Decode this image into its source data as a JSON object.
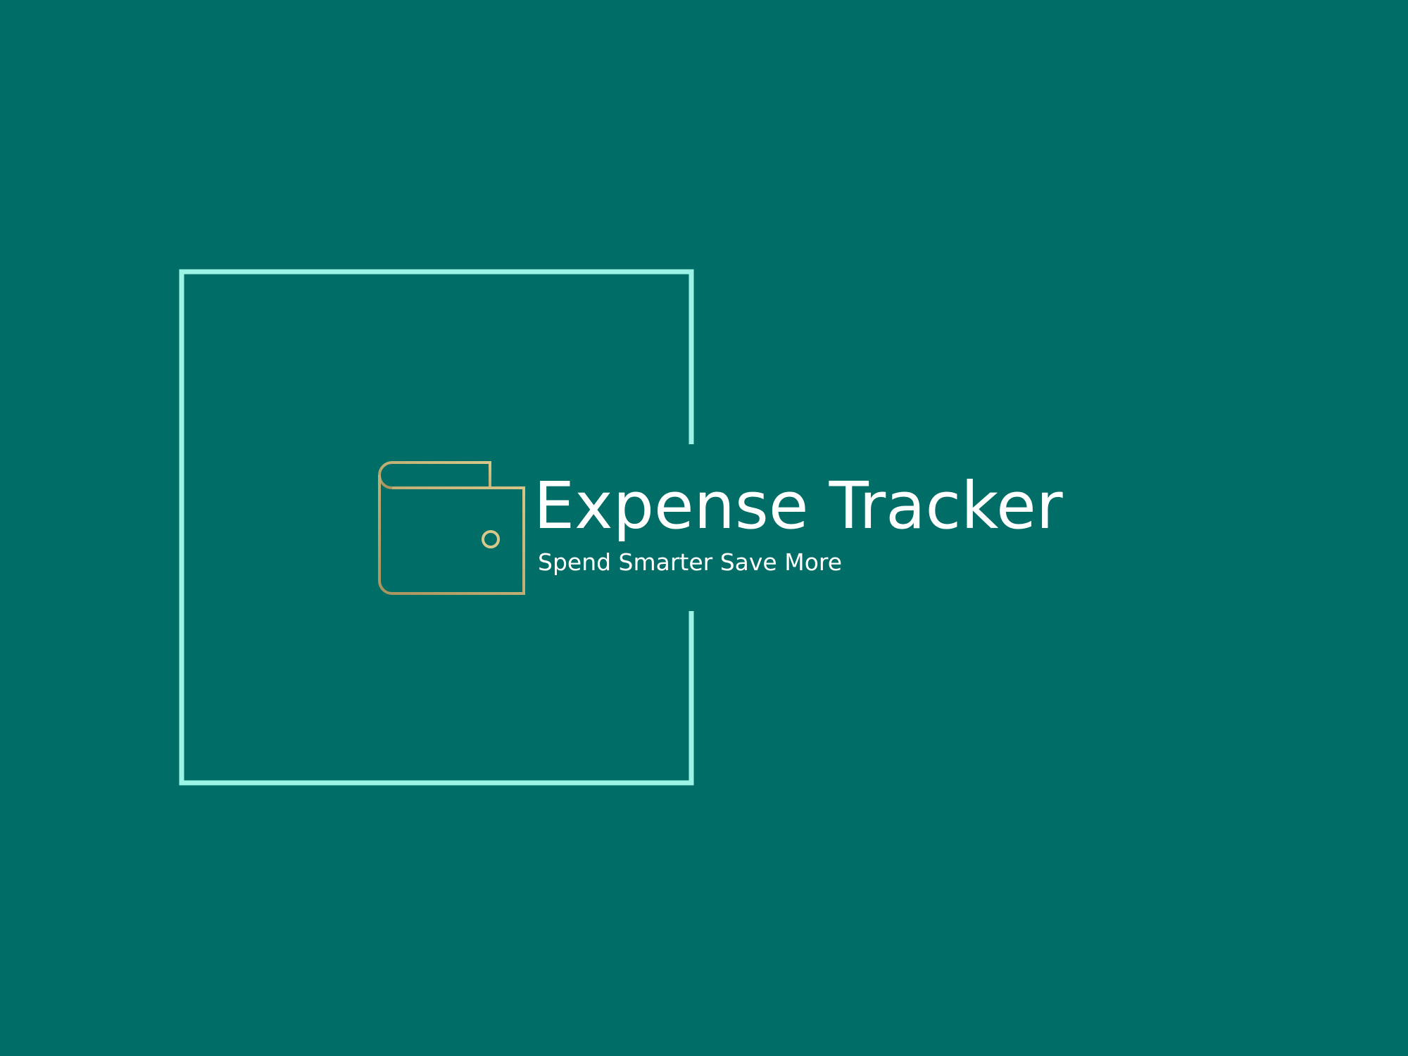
{
  "logo": {
    "title": "Expense Tracker",
    "tagline": "Spend Smarter Save More",
    "icon": "wallet-icon"
  },
  "colors": {
    "background": "#006d66",
    "frame": "#9af3e4",
    "icon_gold_light": "#dac88a",
    "icon_gold_dark": "#a8945c",
    "text": "#ffffff"
  }
}
